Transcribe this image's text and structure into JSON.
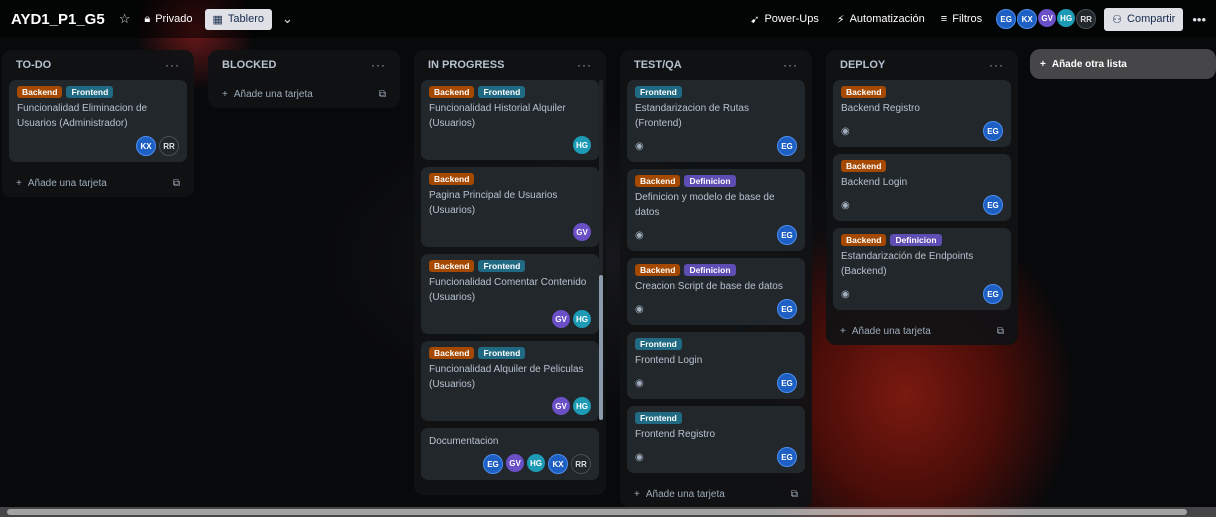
{
  "header": {
    "title": "AYD1_P1_G5",
    "visibility": "Privado",
    "view": "Tablero",
    "powerups": "Power-Ups",
    "automation": "Automatización",
    "filters": "Filtros",
    "share": "Compartir",
    "members": [
      "EG",
      "KX",
      "GV",
      "HG",
      "RR"
    ]
  },
  "lists": [
    {
      "title": "TO-DO",
      "add": "Añade una tarjeta",
      "cards": [
        {
          "labels": [
            "Backend",
            "Frontend"
          ],
          "title": "Funcionalidad Eliminacion de Usuarios (Administrador)",
          "watch": false,
          "members": [
            "KX",
            "RR"
          ]
        }
      ]
    },
    {
      "title": "BLOCKED",
      "add": "Añade una tarjeta",
      "cards": []
    },
    {
      "title": "IN PROGRESS",
      "add": "Añade una tarjeta",
      "cards": [
        {
          "labels": [
            "Backend",
            "Frontend"
          ],
          "title": "Funcionalidad Historial Alquiler (Usuarios)",
          "watch": false,
          "members": [
            "HG"
          ]
        },
        {
          "labels": [
            "Backend"
          ],
          "title": "Pagina Principal de Usuarios (Usuarios)",
          "watch": false,
          "members": [
            "GV"
          ]
        },
        {
          "labels": [
            "Backend",
            "Frontend"
          ],
          "title": "Funcionalidad Comentar Contenido (Usuarios)",
          "watch": false,
          "members": [
            "GV",
            "HG"
          ]
        },
        {
          "labels": [
            "Backend",
            "Frontend"
          ],
          "title": "Funcionalidad Alquiler de Peliculas (Usuarios)",
          "watch": false,
          "members": [
            "GV",
            "HG"
          ]
        },
        {
          "labels": [],
          "title": "Documentacion",
          "watch": false,
          "members": [
            "EG",
            "GV",
            "HG",
            "KX",
            "RR"
          ]
        }
      ]
    },
    {
      "title": "TEST/QA",
      "add": "Añade una tarjeta",
      "cards": [
        {
          "labels": [
            "Frontend"
          ],
          "title": "Estandarizacion de Rutas (Frontend)",
          "watch": true,
          "members": [
            "EG"
          ]
        },
        {
          "labels": [
            "Backend",
            "Definicion"
          ],
          "title": "Definicion y modelo de base de datos",
          "watch": true,
          "members": [
            "EG"
          ]
        },
        {
          "labels": [
            "Backend",
            "Definicion"
          ],
          "title": "Creacion Script de base de datos",
          "watch": true,
          "members": [
            "EG"
          ]
        },
        {
          "labels": [
            "Frontend"
          ],
          "title": "Frontend Login",
          "watch": true,
          "members": [
            "EG"
          ]
        },
        {
          "labels": [
            "Frontend"
          ],
          "title": "Frontend Registro",
          "watch": true,
          "members": [
            "EG"
          ]
        }
      ]
    },
    {
      "title": "DEPLOY",
      "add": "Añade una tarjeta",
      "cards": [
        {
          "labels": [
            "Backend"
          ],
          "title": "Backend Registro",
          "watch": true,
          "members": [
            "EG"
          ]
        },
        {
          "labels": [
            "Backend"
          ],
          "title": "Backend Login",
          "watch": true,
          "members": [
            "EG"
          ]
        },
        {
          "labels": [
            "Backend",
            "Definicion"
          ],
          "title": "Estandarización de Endpoints (Backend)",
          "watch": true,
          "members": [
            "EG"
          ]
        }
      ]
    }
  ],
  "add_list": "Añade otra lista"
}
